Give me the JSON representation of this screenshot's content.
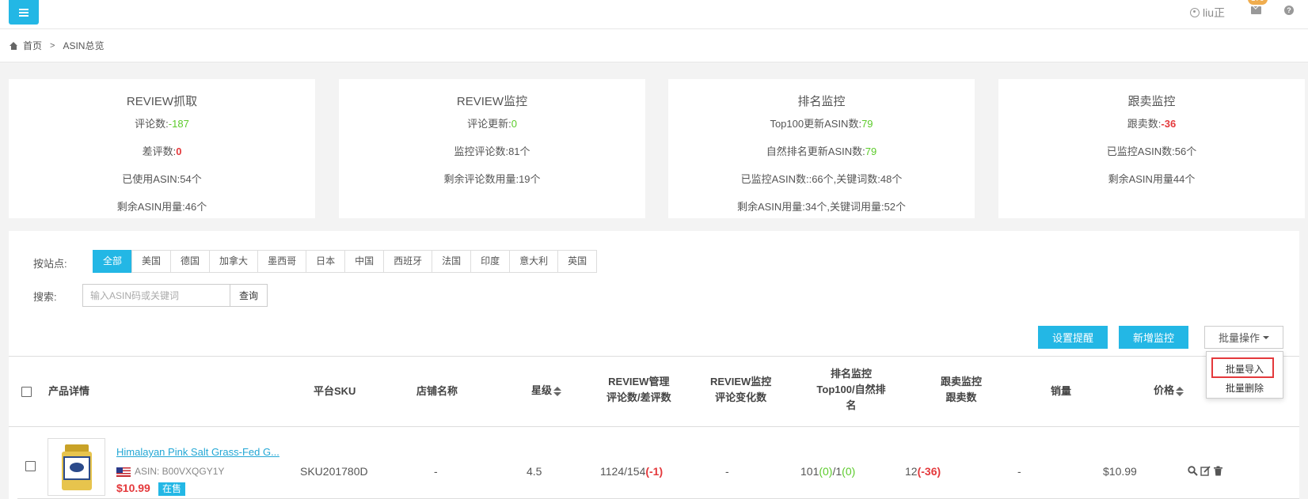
{
  "topbar": {
    "username": "liu正",
    "mail_badge": "179"
  },
  "breadcrumb": {
    "home": "首页",
    "current": "ASIN总览"
  },
  "cards": {
    "review_fetch": {
      "title": "REVIEW抓取",
      "reviews_label": "评论数:",
      "reviews_value": "-187",
      "bad_label": "差评数:",
      "bad_value": "0",
      "used_asin": "已使用ASIN:54个",
      "remaining_asin": "剩余ASIN用量:46个"
    },
    "review_monitor": {
      "title": "REVIEW监控",
      "updates_label": "评论更新:",
      "updates_value": "0",
      "monitored_reviews": "监控评论数:81个",
      "remaining_reviews": "剩余评论数用量:19个"
    },
    "rank_monitor": {
      "title": "排名监控",
      "top100_label": "Top100更新ASIN数:",
      "top100_value": "79",
      "natural_label": "自然排名更新ASIN数:",
      "natural_value": "79",
      "monitored": "已监控ASIN数::66个,关键词数:48个",
      "remaining": "剩余ASIN用量:34个,关键词用量:52个"
    },
    "follow_monitor": {
      "title": "跟卖监控",
      "followers_label": "跟卖数:",
      "followers_value": "-36",
      "monitored_asin": "已监控ASIN数:56个",
      "remaining_asin": "剩余ASIN用量44个"
    }
  },
  "filters": {
    "site_label": "按站点:",
    "sites": [
      "全部",
      "美国",
      "德国",
      "加拿大",
      "墨西哥",
      "日本",
      "中国",
      "西班牙",
      "法国",
      "印度",
      "意大利",
      "英国"
    ],
    "active_site": "全部",
    "search_label": "搜索:",
    "search_placeholder": "输入ASIN码或关键词",
    "search_button": "查询"
  },
  "actions": {
    "set_reminder": "设置提醒",
    "add_monitor": "新增监控",
    "batch_ops": "批量操作",
    "batch_menu": [
      "批量导入",
      "批量删除"
    ]
  },
  "table": {
    "headers": {
      "product": "产品详情",
      "sku": "平台SKU",
      "store": "店铺名称",
      "rating": "星级",
      "review_mgmt_1": "REVIEW管理",
      "review_mgmt_2": "评论数/差评数",
      "review_mon_1": "REVIEW监控",
      "review_mon_2": "评论变化数",
      "rank_1": "排名监控",
      "rank_2": "Top100/自然排",
      "rank_3": "名",
      "follow_1": "跟卖监控",
      "follow_2": "跟卖数",
      "sales": "销量",
      "price": "价格"
    },
    "rows": [
      {
        "title": "Himalayan Pink Salt Grass-Fed G...",
        "asin": "ASIN: B00VXQGY1Y",
        "price": "$10.99",
        "status": "在售",
        "sku": "SKU201780D",
        "store": "-",
        "rating": "4.5",
        "reviews": "1124/154",
        "reviews_delta": "(-1)",
        "review_change": "-",
        "rank_top": "101",
        "rank_top_delta": "(0)",
        "rank_natural": "1",
        "rank_natural_delta": "(0)",
        "followers": "12",
        "followers_delta": "(-36)",
        "sales": "-",
        "price_col": "$10.99"
      }
    ]
  },
  "colors": {
    "accent": "#23b7e5",
    "positive": "#5ccb2b",
    "negative": "#e4393c"
  }
}
